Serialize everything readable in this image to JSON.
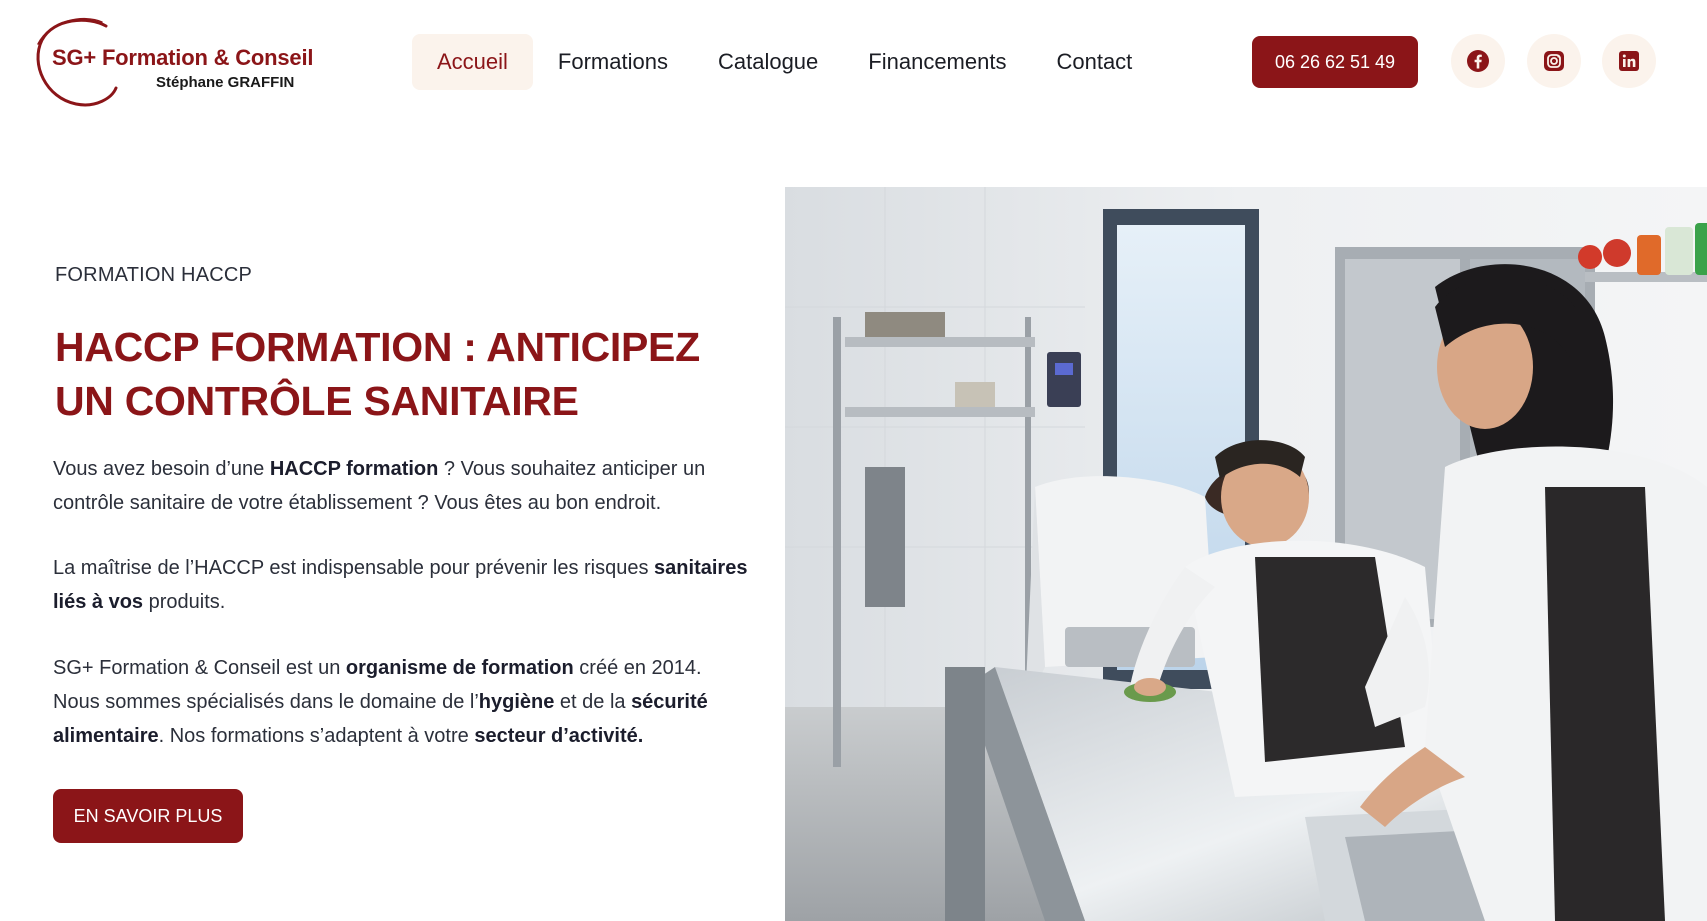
{
  "brand": {
    "name": "SG+ Formation & Conseil",
    "owner": "Stéphane GRAFFIN",
    "color": "#8b1518"
  },
  "nav": {
    "items": [
      {
        "label": "Accueil",
        "active": true
      },
      {
        "label": "Formations",
        "active": false
      },
      {
        "label": "Catalogue",
        "active": false
      },
      {
        "label": "Financements",
        "active": false
      },
      {
        "label": "Contact",
        "active": false
      }
    ]
  },
  "header": {
    "phone": "06 26 62 51 49",
    "social": [
      "facebook-icon",
      "instagram-icon",
      "linkedin-icon"
    ]
  },
  "hero": {
    "eyebrow": "FORMATION HACCP",
    "title": "HACCP FORMATION : ANTICIPEZ UN CONTRÔLE SANITAIRE",
    "p1": {
      "a": "Vous avez besoin d’une ",
      "b": "HACCP formation",
      "c": " ? Vous souhaitez anticiper un contrôle sanitaire de votre établissement ? Vous êtes au bon endroit."
    },
    "p2": {
      "a": "La maîtrise de l’HACCP est indispensable pour prévenir les risques ",
      "b": "sanitaires liés à vos",
      "c": " produits."
    },
    "p3": {
      "a": "SG+ Formation & Conseil est un ",
      "b": "organisme de formation",
      "c": " créé en 2014. Nous sommes spécialisés dans le domaine de l’",
      "d": "hygiène",
      "e": " et de la ",
      "f": "sécurité alimentaire",
      "g": ". Nos formations s’adaptent à votre ",
      "h": "secteur d’activité."
    },
    "cta": "EN SAVOIR PLUS",
    "image": "kitchen-photo-chef-cleaning-counter"
  }
}
